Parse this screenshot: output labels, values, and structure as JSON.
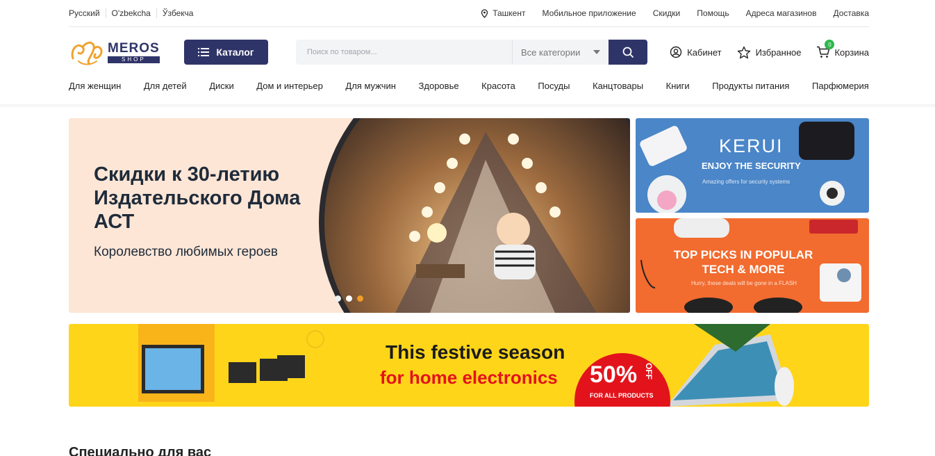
{
  "top_bar": {
    "languages": [
      "Русский",
      "O'zbekcha",
      "Ўзбекча"
    ],
    "city": "Ташкент",
    "links": [
      "Мобильное приложение",
      "Скидки",
      "Помощь",
      "Адреса магазинов",
      "Доставка"
    ]
  },
  "header": {
    "logo_main": "MEROS",
    "logo_sub": "SHOP",
    "catalog_label": "Каталог",
    "search_placeholder": "Поиск по товаром...",
    "search_category": "Все категории",
    "account_label": "Кабинет",
    "favorites_label": "Избранное",
    "cart_label": "Корзина",
    "cart_count": "0"
  },
  "categories": [
    "Для женщин",
    "Для детей",
    "Диски",
    "Дом и интерьер",
    "Для мужчин",
    "Здоровье",
    "Красота",
    "Посуды",
    "Канцтовары",
    "Книги",
    "Продукты питания",
    "Парфюмерия"
  ],
  "hero": {
    "title": "Скидки к 30-летию Издательского Дома АСТ",
    "subtitle": "Королевство любимых героев",
    "slides_count": 3,
    "active_slide": 3
  },
  "side_banners": [
    {
      "title": "KERUI",
      "subtitle": "ENJOY THE SECURITY",
      "note": "Amazing offers for security systems"
    },
    {
      "title": "TOP PICKS IN POPULAR TECH & MORE",
      "note": "Hurry, these deals will be gone in a FLASH"
    }
  ],
  "promo": {
    "line1": "This festive season",
    "line2": "for home electronics",
    "percent": "50%",
    "off": "OFF",
    "note": "FOR ALL PRODUCTS"
  },
  "section_title": "Специально для вас",
  "colors": {
    "brand": "#2f3468",
    "accent": "#f39c28",
    "badge": "#2cb84a"
  }
}
